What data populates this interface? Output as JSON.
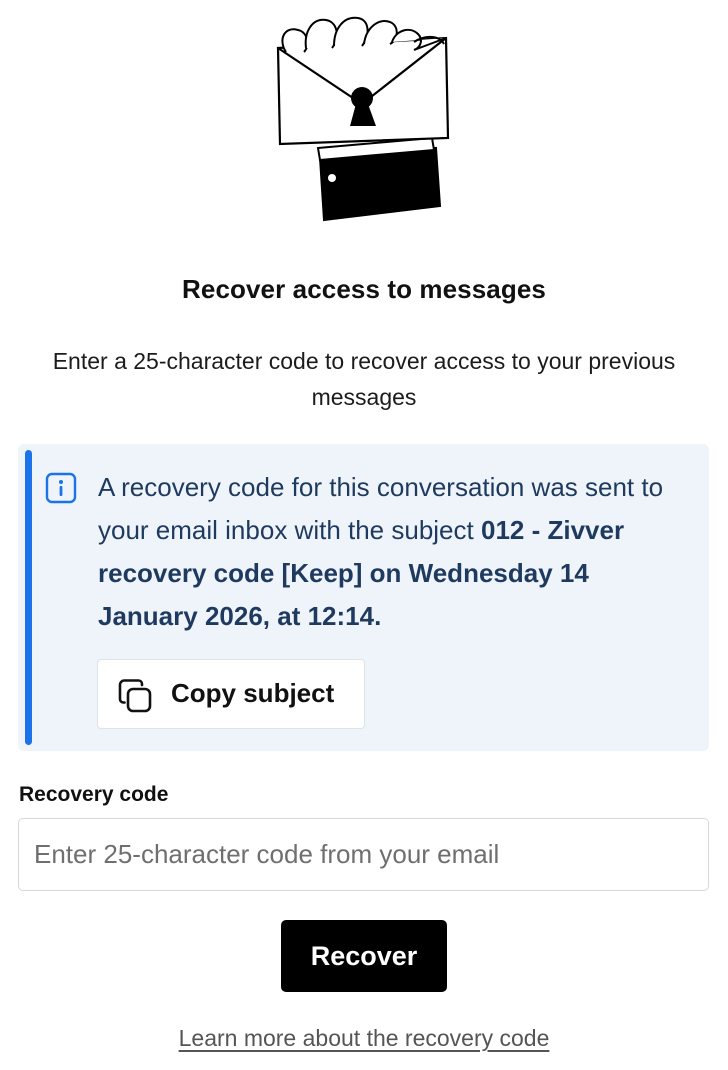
{
  "page": {
    "title": "Recover access to messages",
    "subtitle": "Enter a 25-character code to recover access to your previous messages"
  },
  "info": {
    "text_intro": "A recovery code for this conversation was sent to your email inbox with the subject",
    "subject_bold": "012 - Zivver recovery code [Keep] on Wednesday 14 January 2026, at 12:14.",
    "copy_button_label": "Copy subject",
    "icon": "info-icon",
    "accent_color": "#1a73e8",
    "background_color": "#eff4fb"
  },
  "form": {
    "label": "Recovery code",
    "placeholder": "Enter 25-character code from your email",
    "value": "",
    "submit_label": "Recover"
  },
  "footer": {
    "learn_more_link": "Learn more about the recovery code"
  }
}
